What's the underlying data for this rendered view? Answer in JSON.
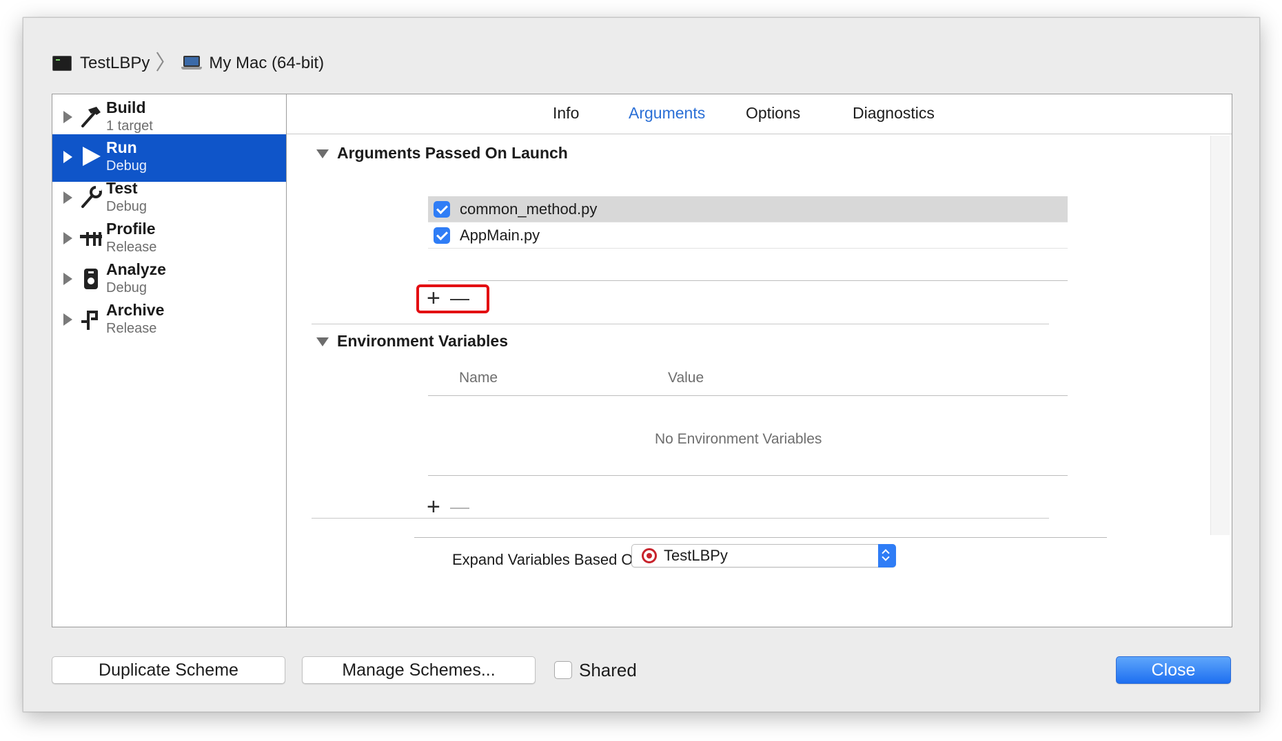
{
  "breadcrumb": {
    "scheme": "TestLBPy",
    "separator": "〉",
    "destination": "My Mac (64-bit)",
    "scheme_icon": "terminal-app-icon",
    "destination_icon": "macbook-icon"
  },
  "sidebar": {
    "items": [
      {
        "title": "Build",
        "subtitle": "1 target",
        "icon": "hammer-icon",
        "selected": false
      },
      {
        "title": "Run",
        "subtitle": "Debug",
        "icon": "play-icon",
        "selected": true
      },
      {
        "title": "Test",
        "subtitle": "Debug",
        "icon": "wrench-icon",
        "selected": false
      },
      {
        "title": "Profile",
        "subtitle": "Release",
        "icon": "instruments-icon",
        "selected": false
      },
      {
        "title": "Analyze",
        "subtitle": "Debug",
        "icon": "analyze-icon",
        "selected": false
      },
      {
        "title": "Archive",
        "subtitle": "Release",
        "icon": "archive-icon",
        "selected": false
      }
    ]
  },
  "tabs": [
    {
      "label": "Info",
      "active": false
    },
    {
      "label": "Arguments",
      "active": true
    },
    {
      "label": "Options",
      "active": false
    },
    {
      "label": "Diagnostics",
      "active": false
    }
  ],
  "arguments_section": {
    "title": "Arguments Passed On Launch",
    "items": [
      {
        "value": "common_method.py",
        "checked": true,
        "selected": true
      },
      {
        "value": "AppMain.py",
        "checked": true,
        "selected": false
      }
    ],
    "add_symbol": "+",
    "remove_symbol": "—",
    "highlight_color": "#e30d12"
  },
  "environment_section": {
    "title": "Environment Variables",
    "col_name": "Name",
    "col_value": "Value",
    "empty_message": "No Environment Variables",
    "add_symbol": "+",
    "remove_symbol": "—"
  },
  "expand": {
    "label": "Expand Variables Based On",
    "selected": "TestLBPy",
    "icon": "target-icon"
  },
  "footer": {
    "duplicate_label": "Duplicate Scheme",
    "manage_label": "Manage Schemes...",
    "shared_label": "Shared",
    "shared_checked": false,
    "close_label": "Close"
  },
  "colors": {
    "selection": "#0f55c9",
    "accent": "#2a6fd6",
    "checkbox": "#2f7df6"
  }
}
